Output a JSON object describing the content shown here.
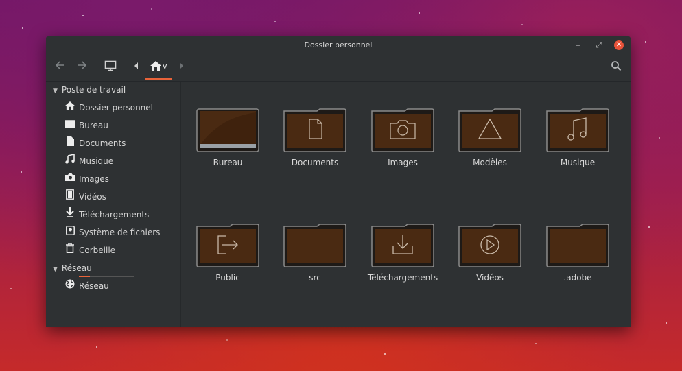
{
  "window": {
    "title": "Dossier personnel"
  },
  "window_controls": {
    "minimize": "‒",
    "maximize": "⤢",
    "close": "✕"
  },
  "toolbar": {
    "breadcrumb_label": "v",
    "accent": "#e9633a"
  },
  "sidebar": {
    "sections": [
      {
        "label": "Poste de travail",
        "items": [
          {
            "label": "Dossier personnel",
            "icon": "home-icon"
          },
          {
            "label": "Bureau",
            "icon": "desktop-folder-icon"
          },
          {
            "label": "Documents",
            "icon": "document-icon"
          },
          {
            "label": "Musique",
            "icon": "music-note-icon"
          },
          {
            "label": "Images",
            "icon": "camera-icon"
          },
          {
            "label": "Vidéos",
            "icon": "film-icon"
          },
          {
            "label": "Téléchargements",
            "icon": "download-arrow-icon"
          },
          {
            "label": "Système de fichiers",
            "icon": "harddisk-icon",
            "usage": 0.2
          },
          {
            "label": "Corbeille",
            "icon": "trash-icon"
          }
        ]
      },
      {
        "label": "Réseau",
        "items": [
          {
            "label": "Réseau",
            "icon": "globe-icon"
          }
        ]
      }
    ]
  },
  "files": [
    {
      "label": "Bureau",
      "icon": "desktop-folder-icon"
    },
    {
      "label": "Documents",
      "icon": "document-icon"
    },
    {
      "label": "Images",
      "icon": "camera-icon"
    },
    {
      "label": "Modèles",
      "icon": "triangle-icon"
    },
    {
      "label": "Musique",
      "icon": "music-note-icon"
    },
    {
      "label": "Public",
      "icon": "share-arrow-icon"
    },
    {
      "label": "src",
      "icon": "folder-icon"
    },
    {
      "label": "Téléchargements",
      "icon": "download-arrow-icon"
    },
    {
      "label": "Vidéos",
      "icon": "play-icon"
    },
    {
      "label": ".adobe",
      "icon": "folder-icon"
    }
  ]
}
